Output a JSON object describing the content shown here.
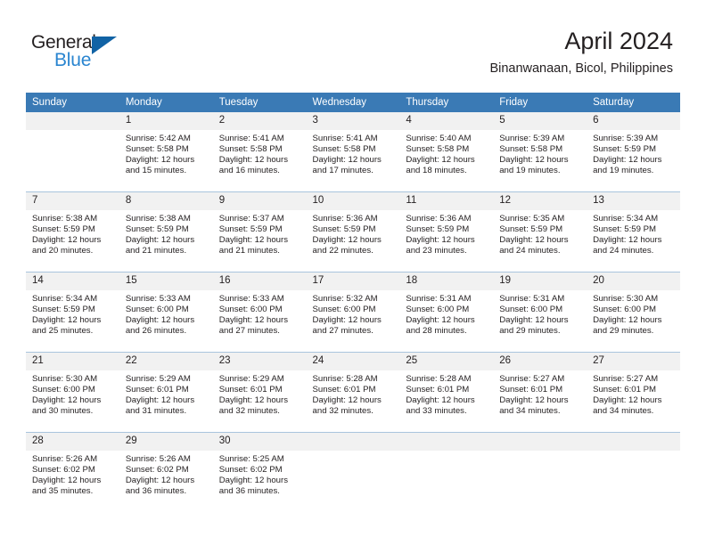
{
  "brand": {
    "name_dark": "General",
    "name_blue": "Blue",
    "accent_blue": "#2a85d0",
    "triangle_blue": "#1163a5"
  },
  "header": {
    "title": "April 2024",
    "subtitle": "Binanwanaan, Bicol, Philippines",
    "header_bg": "#3a7ab5",
    "daynum_bg": "#f1f1f1",
    "row_divider": "#a9c4dd"
  },
  "weekdays": [
    "Sunday",
    "Monday",
    "Tuesday",
    "Wednesday",
    "Thursday",
    "Friday",
    "Saturday"
  ],
  "labels": {
    "sunrise": "Sunrise:",
    "sunset": "Sunset:",
    "daylight": "Daylight:"
  },
  "weeks": [
    [
      {
        "day": "",
        "blank": true,
        "sunrise": "",
        "sunset": "",
        "daylight_line1": "",
        "daylight_line2": ""
      },
      {
        "day": "1",
        "blank": false,
        "sunrise": "Sunrise: 5:42 AM",
        "sunset": "Sunset: 5:58 PM",
        "daylight_line1": "Daylight: 12 hours",
        "daylight_line2": "and 15 minutes."
      },
      {
        "day": "2",
        "blank": false,
        "sunrise": "Sunrise: 5:41 AM",
        "sunset": "Sunset: 5:58 PM",
        "daylight_line1": "Daylight: 12 hours",
        "daylight_line2": "and 16 minutes."
      },
      {
        "day": "3",
        "blank": false,
        "sunrise": "Sunrise: 5:41 AM",
        "sunset": "Sunset: 5:58 PM",
        "daylight_line1": "Daylight: 12 hours",
        "daylight_line2": "and 17 minutes."
      },
      {
        "day": "4",
        "blank": false,
        "sunrise": "Sunrise: 5:40 AM",
        "sunset": "Sunset: 5:58 PM",
        "daylight_line1": "Daylight: 12 hours",
        "daylight_line2": "and 18 minutes."
      },
      {
        "day": "5",
        "blank": false,
        "sunrise": "Sunrise: 5:39 AM",
        "sunset": "Sunset: 5:58 PM",
        "daylight_line1": "Daylight: 12 hours",
        "daylight_line2": "and 19 minutes."
      },
      {
        "day": "6",
        "blank": false,
        "sunrise": "Sunrise: 5:39 AM",
        "sunset": "Sunset: 5:59 PM",
        "daylight_line1": "Daylight: 12 hours",
        "daylight_line2": "and 19 minutes."
      }
    ],
    [
      {
        "day": "7",
        "blank": false,
        "sunrise": "Sunrise: 5:38 AM",
        "sunset": "Sunset: 5:59 PM",
        "daylight_line1": "Daylight: 12 hours",
        "daylight_line2": "and 20 minutes."
      },
      {
        "day": "8",
        "blank": false,
        "sunrise": "Sunrise: 5:38 AM",
        "sunset": "Sunset: 5:59 PM",
        "daylight_line1": "Daylight: 12 hours",
        "daylight_line2": "and 21 minutes."
      },
      {
        "day": "9",
        "blank": false,
        "sunrise": "Sunrise: 5:37 AM",
        "sunset": "Sunset: 5:59 PM",
        "daylight_line1": "Daylight: 12 hours",
        "daylight_line2": "and 21 minutes."
      },
      {
        "day": "10",
        "blank": false,
        "sunrise": "Sunrise: 5:36 AM",
        "sunset": "Sunset: 5:59 PM",
        "daylight_line1": "Daylight: 12 hours",
        "daylight_line2": "and 22 minutes."
      },
      {
        "day": "11",
        "blank": false,
        "sunrise": "Sunrise: 5:36 AM",
        "sunset": "Sunset: 5:59 PM",
        "daylight_line1": "Daylight: 12 hours",
        "daylight_line2": "and 23 minutes."
      },
      {
        "day": "12",
        "blank": false,
        "sunrise": "Sunrise: 5:35 AM",
        "sunset": "Sunset: 5:59 PM",
        "daylight_line1": "Daylight: 12 hours",
        "daylight_line2": "and 24 minutes."
      },
      {
        "day": "13",
        "blank": false,
        "sunrise": "Sunrise: 5:34 AM",
        "sunset": "Sunset: 5:59 PM",
        "daylight_line1": "Daylight: 12 hours",
        "daylight_line2": "and 24 minutes."
      }
    ],
    [
      {
        "day": "14",
        "blank": false,
        "sunrise": "Sunrise: 5:34 AM",
        "sunset": "Sunset: 5:59 PM",
        "daylight_line1": "Daylight: 12 hours",
        "daylight_line2": "and 25 minutes."
      },
      {
        "day": "15",
        "blank": false,
        "sunrise": "Sunrise: 5:33 AM",
        "sunset": "Sunset: 6:00 PM",
        "daylight_line1": "Daylight: 12 hours",
        "daylight_line2": "and 26 minutes."
      },
      {
        "day": "16",
        "blank": false,
        "sunrise": "Sunrise: 5:33 AM",
        "sunset": "Sunset: 6:00 PM",
        "daylight_line1": "Daylight: 12 hours",
        "daylight_line2": "and 27 minutes."
      },
      {
        "day": "17",
        "blank": false,
        "sunrise": "Sunrise: 5:32 AM",
        "sunset": "Sunset: 6:00 PM",
        "daylight_line1": "Daylight: 12 hours",
        "daylight_line2": "and 27 minutes."
      },
      {
        "day": "18",
        "blank": false,
        "sunrise": "Sunrise: 5:31 AM",
        "sunset": "Sunset: 6:00 PM",
        "daylight_line1": "Daylight: 12 hours",
        "daylight_line2": "and 28 minutes."
      },
      {
        "day": "19",
        "blank": false,
        "sunrise": "Sunrise: 5:31 AM",
        "sunset": "Sunset: 6:00 PM",
        "daylight_line1": "Daylight: 12 hours",
        "daylight_line2": "and 29 minutes."
      },
      {
        "day": "20",
        "blank": false,
        "sunrise": "Sunrise: 5:30 AM",
        "sunset": "Sunset: 6:00 PM",
        "daylight_line1": "Daylight: 12 hours",
        "daylight_line2": "and 29 minutes."
      }
    ],
    [
      {
        "day": "21",
        "blank": false,
        "sunrise": "Sunrise: 5:30 AM",
        "sunset": "Sunset: 6:00 PM",
        "daylight_line1": "Daylight: 12 hours",
        "daylight_line2": "and 30 minutes."
      },
      {
        "day": "22",
        "blank": false,
        "sunrise": "Sunrise: 5:29 AM",
        "sunset": "Sunset: 6:01 PM",
        "daylight_line1": "Daylight: 12 hours",
        "daylight_line2": "and 31 minutes."
      },
      {
        "day": "23",
        "blank": false,
        "sunrise": "Sunrise: 5:29 AM",
        "sunset": "Sunset: 6:01 PM",
        "daylight_line1": "Daylight: 12 hours",
        "daylight_line2": "and 32 minutes."
      },
      {
        "day": "24",
        "blank": false,
        "sunrise": "Sunrise: 5:28 AM",
        "sunset": "Sunset: 6:01 PM",
        "daylight_line1": "Daylight: 12 hours",
        "daylight_line2": "and 32 minutes."
      },
      {
        "day": "25",
        "blank": false,
        "sunrise": "Sunrise: 5:28 AM",
        "sunset": "Sunset: 6:01 PM",
        "daylight_line1": "Daylight: 12 hours",
        "daylight_line2": "and 33 minutes."
      },
      {
        "day": "26",
        "blank": false,
        "sunrise": "Sunrise: 5:27 AM",
        "sunset": "Sunset: 6:01 PM",
        "daylight_line1": "Daylight: 12 hours",
        "daylight_line2": "and 34 minutes."
      },
      {
        "day": "27",
        "blank": false,
        "sunrise": "Sunrise: 5:27 AM",
        "sunset": "Sunset: 6:01 PM",
        "daylight_line1": "Daylight: 12 hours",
        "daylight_line2": "and 34 minutes."
      }
    ],
    [
      {
        "day": "28",
        "blank": false,
        "sunrise": "Sunrise: 5:26 AM",
        "sunset": "Sunset: 6:02 PM",
        "daylight_line1": "Daylight: 12 hours",
        "daylight_line2": "and 35 minutes."
      },
      {
        "day": "29",
        "blank": false,
        "sunrise": "Sunrise: 5:26 AM",
        "sunset": "Sunset: 6:02 PM",
        "daylight_line1": "Daylight: 12 hours",
        "daylight_line2": "and 36 minutes."
      },
      {
        "day": "30",
        "blank": false,
        "sunrise": "Sunrise: 5:25 AM",
        "sunset": "Sunset: 6:02 PM",
        "daylight_line1": "Daylight: 12 hours",
        "daylight_line2": "and 36 minutes."
      },
      {
        "day": "",
        "blank": true,
        "sunrise": "",
        "sunset": "",
        "daylight_line1": "",
        "daylight_line2": ""
      },
      {
        "day": "",
        "blank": true,
        "sunrise": "",
        "sunset": "",
        "daylight_line1": "",
        "daylight_line2": ""
      },
      {
        "day": "",
        "blank": true,
        "sunrise": "",
        "sunset": "",
        "daylight_line1": "",
        "daylight_line2": ""
      },
      {
        "day": "",
        "blank": true,
        "sunrise": "",
        "sunset": "",
        "daylight_line1": "",
        "daylight_line2": ""
      }
    ]
  ]
}
